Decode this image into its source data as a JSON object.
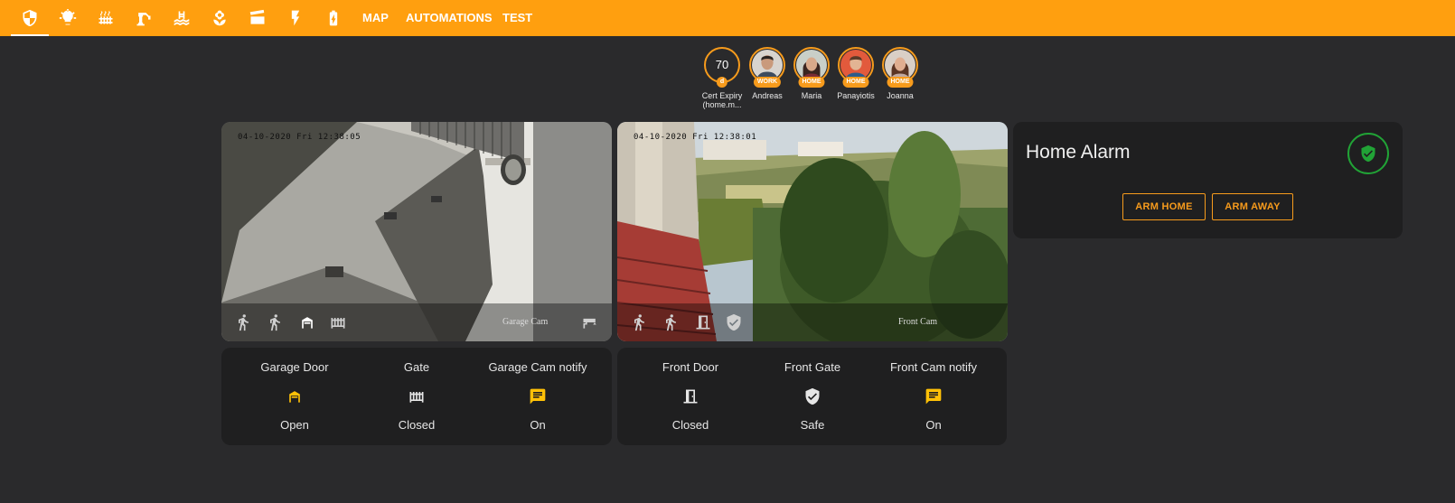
{
  "topbar": {
    "bg": "#ff9f0f",
    "icons": [
      "shield-half-icon",
      "lightbulb-icon",
      "radiator-icon",
      "robot-arm-icon",
      "pool-icon",
      "flower-icon",
      "clapperboard-icon",
      "flash-icon",
      "battery-charging-icon"
    ],
    "text_tabs": [
      "MAP",
      "AUTOMATIONS",
      "TEST"
    ]
  },
  "people": [
    {
      "value": "70",
      "chip": "d",
      "name": "Cert Expiry",
      "name2": "(home.m..."
    },
    {
      "chip": "WORK",
      "name": "Andreas"
    },
    {
      "chip": "HOME",
      "name": "Maria"
    },
    {
      "chip": "HOME",
      "name": "Panayiotis"
    },
    {
      "chip": "HOME",
      "name": "Joanna"
    }
  ],
  "cameras": [
    {
      "timestamp": "04-10-2020 Fri 12:38:05",
      "name": "Garage Cam"
    },
    {
      "timestamp": "04-10-2020 Fri 12:38:01",
      "name": "Front Cam"
    }
  ],
  "garage_card": {
    "entities": [
      {
        "name": "Garage Door",
        "state": "Open",
        "icon": "garage-open-icon",
        "color": "#ffc107"
      },
      {
        "name": "Gate",
        "state": "Closed",
        "icon": "gate-icon",
        "color": "#e6e6e6"
      },
      {
        "name": "Garage Cam notify",
        "state": "On",
        "icon": "message-text-icon",
        "color": "#ffc107"
      }
    ]
  },
  "front_card": {
    "entities": [
      {
        "name": "Front Door",
        "state": "Closed",
        "icon": "door-closed-icon",
        "color": "#e6e6e6"
      },
      {
        "name": "Front Gate",
        "state": "Safe",
        "icon": "shield-check-icon",
        "color": "#e6e6e6"
      },
      {
        "name": "Front Cam notify",
        "state": "On",
        "icon": "message-text-icon",
        "color": "#ffc107"
      }
    ]
  },
  "alarm": {
    "title": "Home Alarm",
    "status_color": "#21a336",
    "arm_home": "ARM HOME",
    "arm_away": "ARM AWAY"
  }
}
